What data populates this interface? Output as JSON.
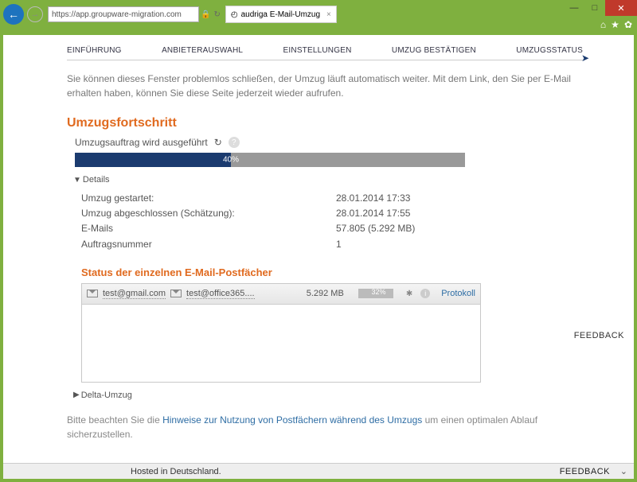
{
  "window": {
    "min": "—",
    "max": "□",
    "close": "✕"
  },
  "browser": {
    "url": "https://app.groupware-migration.com",
    "lock": "🔒",
    "refresh": "↻",
    "tab_title": "audriga E-Mail-Umzug",
    "tab_icon": "◴",
    "home": "⌂",
    "star": "★",
    "gear": "✿"
  },
  "stepper": [
    "EINFÜHRUNG",
    "ANBIETERAUSWAHL",
    "EINSTELLUNGEN",
    "UMZUG BESTÄTIGEN",
    "UMZUGSSTATUS"
  ],
  "intro": "Sie können dieses Fenster problemlos schließen, der Umzug läuft automatisch weiter. Mit dem Link, den Sie per E-Mail erhalten haben, können Sie diese Seite jederzeit wieder aufrufen.",
  "progress": {
    "heading": "Umzugsfortschritt",
    "status": "Umzugsauftrag wird ausgeführt",
    "refresh": "↻",
    "percent_label": "40%"
  },
  "details": {
    "toggle": "Details",
    "rows": [
      {
        "label": "Umzug gestartet:",
        "value": "28.01.2014 17:33"
      },
      {
        "label": "Umzug abgeschlossen (Schätzung):",
        "value": "28.01.2014 17:55"
      },
      {
        "label": "E-Mails",
        "value": "57.805 (5.292 MB)"
      },
      {
        "label": "Auftragsnummer",
        "value": "1"
      }
    ]
  },
  "mailboxes": {
    "heading": "Status der einzelnen E-Mail-Postfächer",
    "row": {
      "from": "test@gmail.com",
      "to": "test@office365....",
      "size": "5.292 MB",
      "pct": "32%",
      "protocol": "Protokoll"
    }
  },
  "delta": "Delta-Umzug",
  "notice": {
    "pre": "Bitte beachten Sie die ",
    "link": "Hinweise zur Nutzung von Postfächern während des Umzugs",
    "post": " um einen optimalen Ablauf sicherzustellen."
  },
  "feedback": "FEEDBACK",
  "bottom": {
    "hosted": "Hosted in Deutschland.",
    "feedback": "FEEDBACK"
  }
}
